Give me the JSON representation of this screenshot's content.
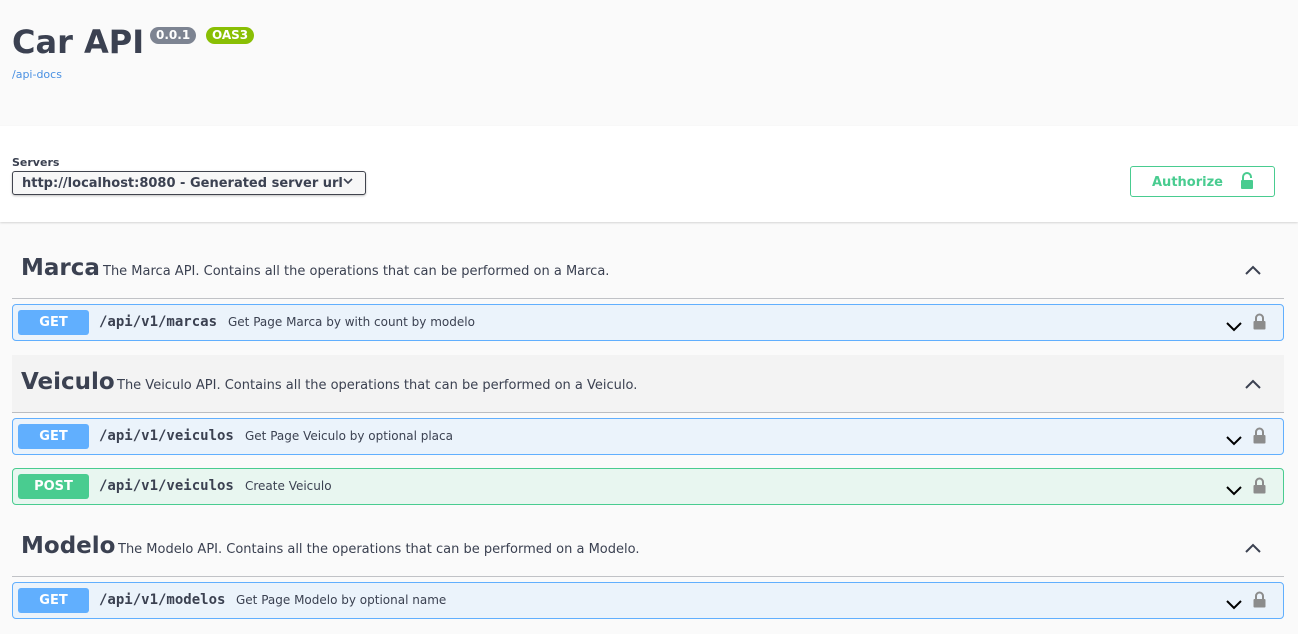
{
  "info": {
    "title": "Car API",
    "version_badge": "0.0.1",
    "oas_badge": "OAS3",
    "docs_link": "/api-docs"
  },
  "servers": {
    "label": "Servers",
    "selected": "http://localhost:8080 - Generated server url"
  },
  "authorize": {
    "label": "Authorize"
  },
  "tags": [
    {
      "name": "Marca",
      "description": "The Marca API. Contains all the operations that can be performed on a Marca.",
      "operations": [
        {
          "method": "GET",
          "path": "/api/v1/marcas",
          "summary": "Get Page Marca by with count by modelo"
        }
      ]
    },
    {
      "name": "Veiculo",
      "description": "The Veiculo API. Contains all the operations that can be performed on a Veiculo.",
      "operations": [
        {
          "method": "GET",
          "path": "/api/v1/veiculos",
          "summary": "Get Page Veiculo by optional placa"
        },
        {
          "method": "POST",
          "path": "/api/v1/veiculos",
          "summary": "Create Veiculo"
        }
      ]
    },
    {
      "name": "Modelo",
      "description": "The Modelo API. Contains all the operations that can be performed on a Modelo.",
      "operations": [
        {
          "method": "GET",
          "path": "/api/v1/modelos",
          "summary": "Get Page Modelo by optional name"
        }
      ]
    }
  ],
  "colors": {
    "get": "#61affe",
    "post": "#49cc90",
    "authorize": "#49cc90",
    "version_badge": "#7d8492",
    "oas_badge": "#89bf04",
    "link": "#4990e2"
  },
  "icons": {
    "server_select": "chevron-down-icon",
    "authorize": "lock-icon",
    "tag_toggle": "chevron-up-icon",
    "op_toggle": "chevron-down-icon",
    "op_auth": "lock-icon"
  }
}
